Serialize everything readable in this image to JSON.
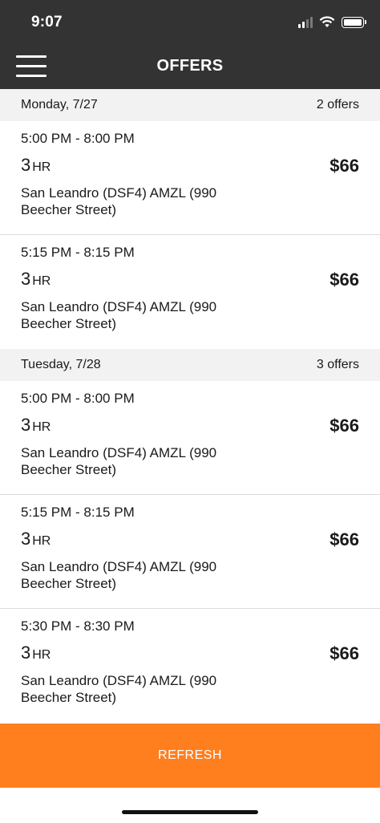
{
  "status_bar": {
    "time": "9:07"
  },
  "header": {
    "title": "OFFERS"
  },
  "groups": [
    {
      "day": "Monday, 7/27",
      "count": "2 offers",
      "offers": [
        {
          "time": "5:00 PM - 8:00 PM",
          "duration_num": "3",
          "duration_unit": "HR",
          "price": "$66",
          "location": "San Leandro (DSF4) AMZL (990 Beecher Street)"
        },
        {
          "time": "5:15 PM - 8:15 PM",
          "duration_num": "3",
          "duration_unit": "HR",
          "price": "$66",
          "location": "San Leandro (DSF4) AMZL (990 Beecher Street)"
        }
      ]
    },
    {
      "day": "Tuesday, 7/28",
      "count": "3 offers",
      "offers": [
        {
          "time": "5:00 PM - 8:00 PM",
          "duration_num": "3",
          "duration_unit": "HR",
          "price": "$66",
          "location": "San Leandro (DSF4) AMZL (990 Beecher Street)"
        },
        {
          "time": "5:15 PM - 8:15 PM",
          "duration_num": "3",
          "duration_unit": "HR",
          "price": "$66",
          "location": "San Leandro (DSF4) AMZL (990 Beecher Street)"
        },
        {
          "time": "5:30 PM - 8:30 PM",
          "duration_num": "3",
          "duration_unit": "HR",
          "price": "$66",
          "location": "San Leandro (DSF4) AMZL (990 Beecher Street)"
        }
      ]
    }
  ],
  "refresh_label": "REFRESH",
  "colors": {
    "header_bg": "#333333",
    "accent": "#ff7f1e",
    "day_header_bg": "#f2f2f2"
  }
}
